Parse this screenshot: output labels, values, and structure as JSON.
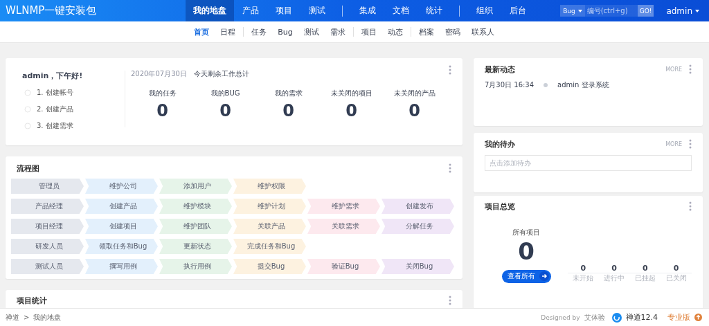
{
  "brand": "WLNMP一键安装包",
  "main_nav": [
    [
      {
        "label": "我的地盘",
        "selected": true
      },
      {
        "label": "产品",
        "selected": false
      },
      {
        "label": "项目",
        "selected": false
      },
      {
        "label": "测试",
        "selected": false
      }
    ],
    [
      {
        "label": "集成",
        "selected": false
      },
      {
        "label": "文档",
        "selected": false
      },
      {
        "label": "统计",
        "selected": false
      }
    ],
    [
      {
        "label": "组织",
        "selected": false
      },
      {
        "label": "后台",
        "selected": false
      }
    ]
  ],
  "search": {
    "type": "Bug",
    "placeholder": "编号(ctrl+g)",
    "go": "GO!"
  },
  "user": "admin",
  "sub_nav": [
    [
      {
        "label": "首页",
        "selected": true
      },
      {
        "label": "日程",
        "selected": false
      }
    ],
    [
      {
        "label": "任务",
        "selected": false
      },
      {
        "label": "Bug",
        "selected": false
      },
      {
        "label": "测试",
        "selected": false
      },
      {
        "label": "需求",
        "selected": false
      }
    ],
    [
      {
        "label": "项目",
        "selected": false
      },
      {
        "label": "动态",
        "selected": false
      }
    ],
    [
      {
        "label": "档案",
        "selected": false
      },
      {
        "label": "密码",
        "selected": false
      },
      {
        "label": "联系人",
        "selected": false
      }
    ]
  ],
  "welcome": {
    "greeting": "admin，下午好!",
    "steps": [
      "1. 创建帐号",
      "2. 创建产品",
      "3. 创建需求"
    ],
    "date": "2020年07月30日",
    "summary": "今天剩余工作总计",
    "stats": [
      {
        "label": "我的任务",
        "value": "0"
      },
      {
        "label": "我的BUG",
        "value": "0"
      },
      {
        "label": "我的需求",
        "value": "0"
      },
      {
        "label": "未关闭的项目",
        "value": "0"
      },
      {
        "label": "未关闭的产品",
        "value": "0"
      }
    ]
  },
  "flow": {
    "title": "流程图",
    "rows": [
      {
        "role": "管理员",
        "steps": [
          {
            "label": "维护公司",
            "color": "#e3f0fc"
          },
          {
            "label": "添加用户",
            "color": "#e6f4e9"
          },
          {
            "label": "维护权限",
            "color": "#fdf2e0"
          }
        ]
      },
      {
        "role": "产品经理",
        "steps": [
          {
            "label": "创建产品",
            "color": "#e3f0fc"
          },
          {
            "label": "维护模块",
            "color": "#e6f4e9"
          },
          {
            "label": "维护计划",
            "color": "#fdf2e0"
          },
          {
            "label": "维护需求",
            "color": "#fde9ee"
          },
          {
            "label": "创建发布",
            "color": "#f0e6f7"
          }
        ]
      },
      {
        "role": "项目经理",
        "steps": [
          {
            "label": "创建项目",
            "color": "#e3f0fc"
          },
          {
            "label": "维护团队",
            "color": "#e6f4e9"
          },
          {
            "label": "关联产品",
            "color": "#fdf2e0"
          },
          {
            "label": "关联需求",
            "color": "#fde9ee"
          },
          {
            "label": "分解任务",
            "color": "#f0e6f7"
          }
        ]
      },
      {
        "role": "研发人员",
        "steps": [
          {
            "label": "领取任务和Bug",
            "color": "#e3f0fc"
          },
          {
            "label": "更新状态",
            "color": "#e6f4e9"
          },
          {
            "label": "完成任务和Bug",
            "color": "#fdf2e0"
          }
        ]
      },
      {
        "role": "测试人员",
        "steps": [
          {
            "label": "撰写用例",
            "color": "#e3f0fc"
          },
          {
            "label": "执行用例",
            "color": "#e6f4e9"
          },
          {
            "label": "提交Bug",
            "color": "#fdf2e0"
          },
          {
            "label": "验证Bug",
            "color": "#fde9ee"
          },
          {
            "label": "关闭Bug",
            "color": "#f0e6f7"
          }
        ]
      }
    ]
  },
  "project_stats": {
    "title": "项目统计"
  },
  "dynamics": {
    "title": "最新动态",
    "more": "MORE",
    "items": [
      {
        "time": "7月30日 16:34",
        "text": "admin 登录系统"
      }
    ]
  },
  "todo": {
    "title": "我的待办",
    "more": "MORE",
    "placeholder": "点击添加待办"
  },
  "overview": {
    "title": "项目总览",
    "all_label": "所有项目",
    "all_value": "0",
    "view_all": "查看所有",
    "counts": [
      {
        "value": "0",
        "label": "未开始"
      },
      {
        "value": "0",
        "label": "进行中"
      },
      {
        "value": "0",
        "label": "已挂起"
      },
      {
        "value": "0",
        "label": "已关闭"
      }
    ]
  },
  "footer": {
    "breadcrumb": [
      "禅道",
      "我的地盘"
    ],
    "sep": ">",
    "designed": "Designed by",
    "designer": "艾体验",
    "version": "禅道12.4",
    "edition": "专业版"
  }
}
